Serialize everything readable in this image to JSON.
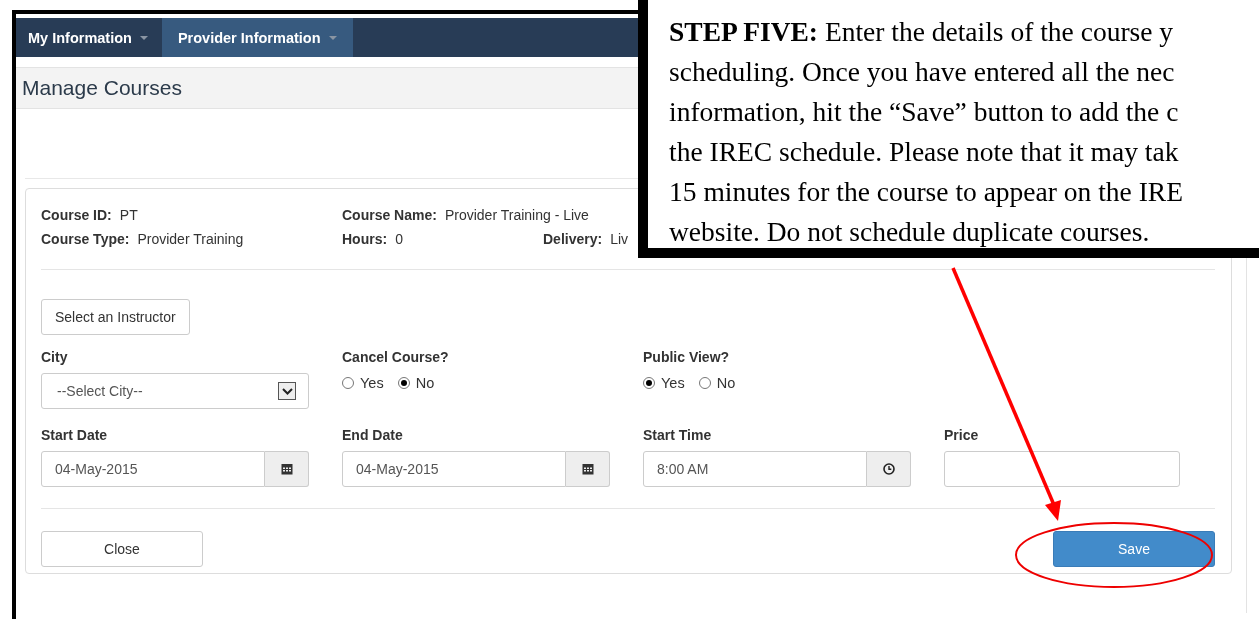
{
  "nav": {
    "items": [
      {
        "label": "My Information",
        "selected": false
      },
      {
        "label": "Provider Information",
        "selected": true
      }
    ]
  },
  "page": {
    "title": "Manage Courses"
  },
  "course": {
    "summary": [
      {
        "label": "Course ID:",
        "value": "PT"
      },
      {
        "label": "Course Name:",
        "value": "Provider Training - Live"
      },
      {
        "label": "Course Type:",
        "value": "Provider Training"
      },
      {
        "label": "Hours:",
        "value": "0"
      },
      {
        "label": "Delivery:",
        "value": "Liv"
      }
    ],
    "instructor_button": "Select an Instructor",
    "city": {
      "label": "City",
      "value": "--Select City--"
    },
    "cancel_course": {
      "label": "Cancel Course?",
      "options": [
        {
          "label": "Yes",
          "selected": false
        },
        {
          "label": "No",
          "selected": true
        }
      ]
    },
    "public_view": {
      "label": "Public View?",
      "options": [
        {
          "label": "Yes",
          "selected": true
        },
        {
          "label": "No",
          "selected": false
        }
      ]
    },
    "start_date": {
      "label": "Start Date",
      "value": "04-May-2015"
    },
    "end_date": {
      "label": "End Date",
      "value": "04-May-2015"
    },
    "start_time": {
      "label": "Start Time",
      "value": "8:00 AM"
    },
    "price": {
      "label": "Price"
    },
    "buttons": [
      {
        "label": "Close",
        "kind": "default"
      },
      {
        "label": "Save",
        "kind": "primary"
      }
    ]
  },
  "callout": {
    "lines": [
      "**STEP FIVE:** Enter the details of the course y",
      "scheduling. Once you have entered all the nec",
      "information, hit the “Save” button to add the c",
      "the IREC schedule. Please note that it may tak",
      "15 minutes for the course to appear on the IRE",
      "website. Do not schedule duplicate courses."
    ]
  }
}
